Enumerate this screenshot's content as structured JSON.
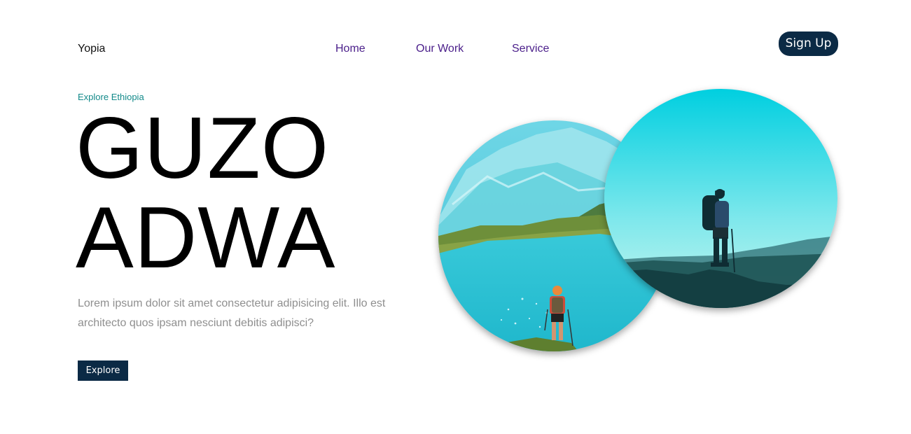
{
  "header": {
    "brand": "Yopia",
    "nav": [
      "Home",
      "Our Work",
      "Service"
    ],
    "signup_label": "Sign Up"
  },
  "hero": {
    "eyebrow": "Explore Ethiopia",
    "headline_line1": "GUZO",
    "headline_line2": "ADWA",
    "description": "Lorem ipsum dolor sit amet consectetur adipisicing elit. Illo est architecto quos ipsam nesciunt debitis adipisci?",
    "cta_label": "Explore"
  },
  "images": {
    "left": "hiker-at-mountain-lake-photo",
    "right": "hiker-on-ridge-silhouette-photo"
  },
  "colors": {
    "accent": "#0b2a45",
    "nav_link": "#4a1e8a",
    "eyebrow": "#138a8a",
    "body_text": "#8f8f8f"
  }
}
